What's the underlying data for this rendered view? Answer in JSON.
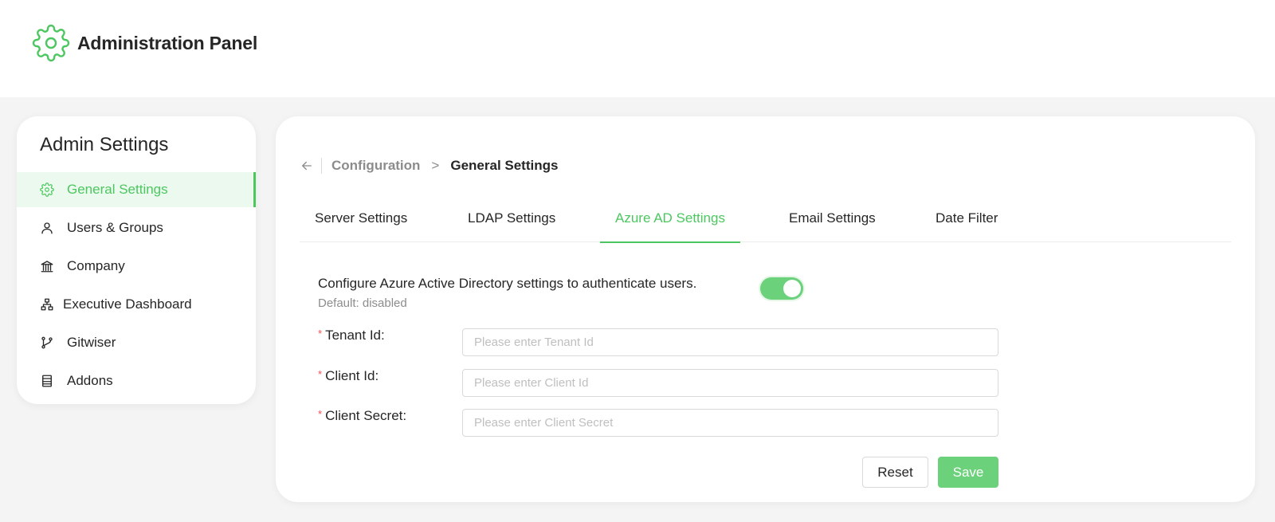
{
  "header": {
    "title": "Administration Panel",
    "icon": "gear-icon"
  },
  "sidebar": {
    "title": "Admin Settings",
    "items": [
      {
        "label": "General Settings",
        "icon": "gear-icon",
        "active": true
      },
      {
        "label": "Users & Groups",
        "icon": "user-icon"
      },
      {
        "label": "Company",
        "icon": "building-icon"
      },
      {
        "label": "Executive Dashboard",
        "icon": "org-chart-icon"
      },
      {
        "label": "Gitwiser",
        "icon": "git-branch-icon"
      },
      {
        "label": "Addons",
        "icon": "addons-icon"
      }
    ]
  },
  "breadcrumb": {
    "parent": "Configuration",
    "separator": ">",
    "current": "General Settings"
  },
  "tabs": [
    {
      "label": "Server Settings"
    },
    {
      "label": "LDAP Settings"
    },
    {
      "label": "Azure AD Settings",
      "active": true
    },
    {
      "label": "Email Settings"
    },
    {
      "label": "Date Filter"
    }
  ],
  "azure": {
    "description": "Configure Azure Active Directory settings to authenticate users.",
    "default_note": "Default: disabled",
    "enabled": true
  },
  "form": {
    "fields": [
      {
        "label": "Tenant Id",
        "placeholder": "Please enter Tenant Id",
        "value": "",
        "required": true
      },
      {
        "label": "Client Id",
        "placeholder": "Please enter Client Id",
        "value": "",
        "required": true
      },
      {
        "label": "Client Secret",
        "placeholder": "Please enter Client Secret",
        "value": "",
        "required": true
      }
    ],
    "required_mark": "*",
    "label_suffix": ":",
    "reset_label": "Reset",
    "save_label": "Save"
  },
  "colors": {
    "accent": "#4cc760",
    "toggle": "#6bd27b",
    "required": "#ff4d4f"
  }
}
